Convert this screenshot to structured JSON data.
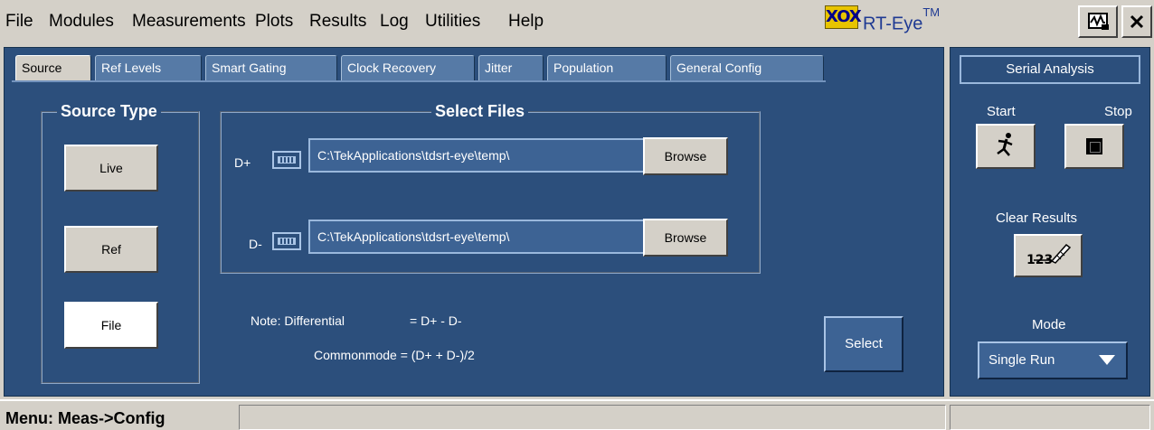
{
  "menubar": {
    "items": [
      "File",
      "Modules",
      "Measurements",
      "Plots",
      "Results",
      "Log",
      "Utilities",
      "Help"
    ],
    "logo_text": "XOX",
    "brand": "RT-Eye",
    "brand_tm": "TM"
  },
  "tabs": [
    {
      "label": "Source",
      "active": true
    },
    {
      "label": "Ref Levels"
    },
    {
      "label": "Smart Gating"
    },
    {
      "label": "Clock Recovery"
    },
    {
      "label": "Jitter"
    },
    {
      "label": "Population"
    },
    {
      "label": "General Config"
    }
  ],
  "source_type": {
    "title": "Source Type",
    "buttons": [
      "Live",
      "Ref",
      "File"
    ],
    "selected": "File"
  },
  "select_files": {
    "title": "Select Files",
    "rows": [
      {
        "label": "D+",
        "path": "C:\\TekApplications\\tdsrt-eye\\temp\\",
        "browse": "Browse"
      },
      {
        "label": "D-",
        "path": "C:\\TekApplications\\tdsrt-eye\\temp\\",
        "browse": "Browse"
      }
    ]
  },
  "note": {
    "line1_label": "Note: Differential",
    "line1_value": "= D+ - D-",
    "line2": "Commonmode = (D+ + D-)/2"
  },
  "select_button": "Select",
  "side": {
    "header": "Serial Analysis",
    "start_label": "Start",
    "stop_label": "Stop",
    "clear_label": "Clear Results",
    "clear_icon_text": "123",
    "mode_label": "Mode",
    "mode_value": "Single Run"
  },
  "status": {
    "text": "Menu: Meas->Config"
  },
  "colors": {
    "panel": "#2c4f7c",
    "tab": "#567aa6",
    "chrome": "#d4d0c8"
  }
}
